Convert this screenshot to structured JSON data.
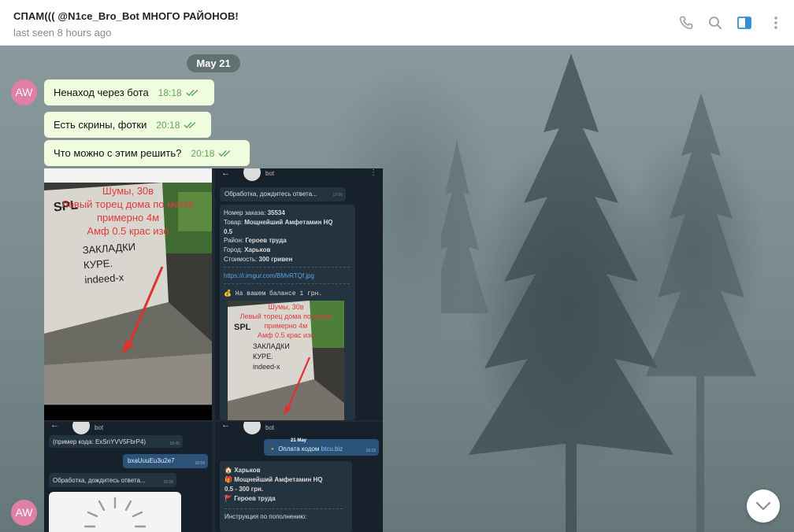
{
  "header": {
    "title": "СПАМ((( @N1ce_Bro_Bot МНОГО РАЙОНОВ!",
    "status": "last seen 8 hours ago"
  },
  "chat": {
    "date_label": "May 21",
    "avatar_initials": "AW",
    "messages": [
      {
        "text": "Ненаход через бота",
        "time": "18:18"
      },
      {
        "text": "Есть скрины, фотки",
        "time": "20:18"
      },
      {
        "text": "Что можно с этим решить?",
        "time": "20:18"
      }
    ],
    "screenshot_tl": {
      "overlay_lines": [
        "Шумы, 30в",
        "Левый торец дома по метке",
        "примерно 4м",
        "Амф 0.5 крас изо"
      ],
      "wall_text": [
        "SPL",
        "ЗАКЛАДКИ",
        "КУРЕ.",
        "indeed-x"
      ]
    },
    "screenshot_tr": {
      "bot_name": "bot",
      "processing": "Обработка, дождитесь ответа...",
      "processing_time": "17:00",
      "order_lines": [
        {
          "label": "Номер заказа: ",
          "value": "35534"
        },
        {
          "label": "Товар: ",
          "value": "Мощнейший Амфетамин HQ"
        },
        {
          "label": "",
          "value": "0.5"
        },
        {
          "label": "Район: ",
          "value": "Героев труда"
        },
        {
          "label": "Город: ",
          "value": "Харьков"
        },
        {
          "label": "Стоимость: ",
          "value": "300 гривен"
        }
      ],
      "link": "https://i.imgur.com/BMvRTQf.jpg",
      "balance": "На вашем балансе 1 грн."
    },
    "screenshot_bl": {
      "bot_name": "bot",
      "code_hint": "(пример кода: ExSnYVV5FbrP4)",
      "code_hint_time": "16:45",
      "user_code": "bxaUuuEu3u2e7",
      "user_code_time": "16:59",
      "processing": "Обработка, дождитесь ответа...",
      "processing_time": "16:59"
    },
    "screenshot_br": {
      "bot_name": "bot",
      "date_chip": "21 May",
      "pay_text": "Оплата кодом",
      "pay_link": "btcu.biz",
      "pay_time": "16:29",
      "city": "Харьков",
      "product": "Мощнейший Амфетамин HQ",
      "price": "0.5 - 300 грн.",
      "district": "Героев труда",
      "instruction": "Инструкция по пополнению:"
    }
  },
  "colors": {
    "avatar": "#e17fa7",
    "bubble": "#effdde",
    "time": "#5fa758",
    "accent": "#2f8fd6"
  }
}
